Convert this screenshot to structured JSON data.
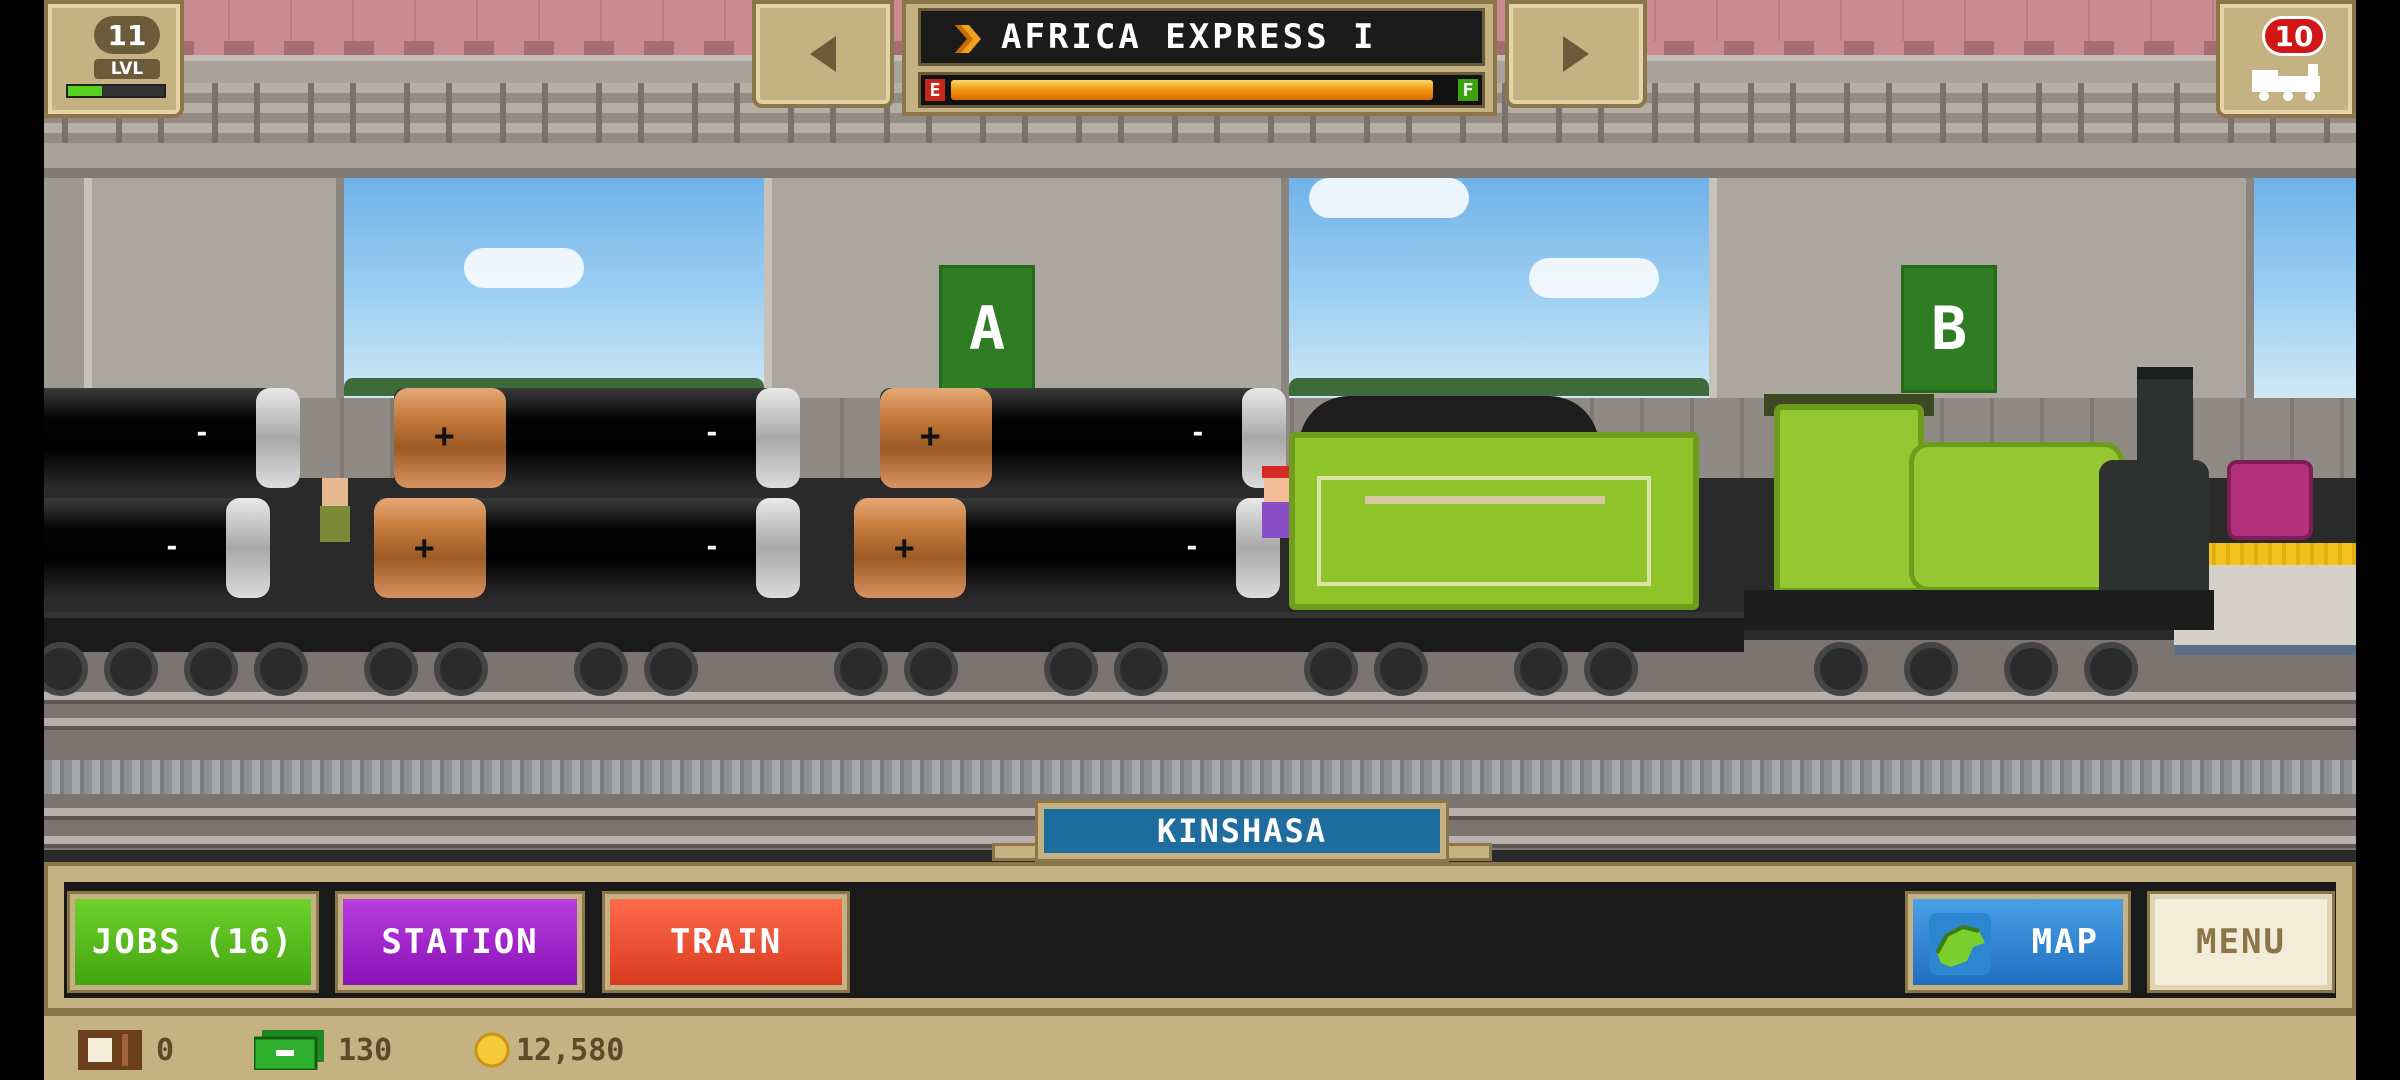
{
  "level": {
    "number": "11",
    "label": "LVL",
    "xp_progress": 0.35
  },
  "train_selector": {
    "title": "AFRICA EXPRESS I",
    "fuel_empty_label": "E",
    "fuel_full_label": "F",
    "fuel_level": 0.95
  },
  "trains_count": "10",
  "platforms": {
    "a_label": "A",
    "b_label": "B"
  },
  "station_name": "KINSHASA",
  "buttons": {
    "jobs_label": "JOBS (16)",
    "station_label": "STATION",
    "train_label": "TRAIN",
    "map_label": "MAP",
    "menu_label": "MENU"
  },
  "currencies": {
    "crates": "0",
    "cash": "130",
    "coins": "12,580"
  },
  "colors": {
    "jobs": "#52b81a",
    "station": "#9a1dc4",
    "train": "#e44c30",
    "map": "#2b82d4",
    "hud_tan": "#c5b283"
  }
}
